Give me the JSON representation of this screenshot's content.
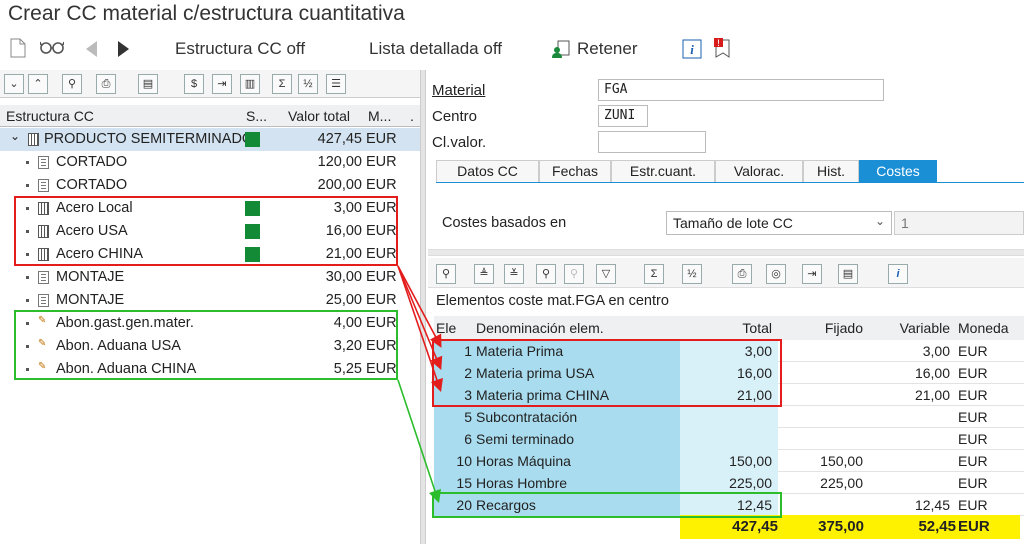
{
  "window": {
    "title": "Crear CC material c/estructura cuantitativa"
  },
  "toolbar": {
    "estructura_off": "Estructura CC off",
    "lista_off": "Lista detallada off",
    "retener": "Retener"
  },
  "tree": {
    "headers": {
      "estructura": "Estructura CC",
      "s": "S...",
      "valor": "Valor total",
      "m": "M...",
      "dot": "."
    },
    "rows": [
      {
        "label": "PRODUCTO SEMITERMINADO",
        "value": "427,45",
        "cur": "EUR"
      },
      {
        "label": "CORTADO",
        "value": "120,00",
        "cur": "EUR"
      },
      {
        "label": "CORTADO",
        "value": "200,00",
        "cur": "EUR"
      },
      {
        "label": "Acero Local",
        "value": "3,00",
        "cur": "EUR"
      },
      {
        "label": "Acero USA",
        "value": "16,00",
        "cur": "EUR"
      },
      {
        "label": "Acero CHINA",
        "value": "21,00",
        "cur": "EUR"
      },
      {
        "label": "MONTAJE",
        "value": "30,00",
        "cur": "EUR"
      },
      {
        "label": "MONTAJE",
        "value": "25,00",
        "cur": "EUR"
      },
      {
        "label": "Abon.gast.gen.mater.",
        "value": "4,00",
        "cur": "EUR"
      },
      {
        "label": "Abon. Aduana USA",
        "value": "3,20",
        "cur": "EUR"
      },
      {
        "label": "Abon. Aduana CHINA",
        "value": "5,25",
        "cur": "EUR"
      }
    ]
  },
  "form": {
    "material_label": "Material",
    "material_value": "FGA",
    "centro_label": "Centro",
    "centro_value": "ZUNI",
    "clvalor_label": "Cl.valor.",
    "clvalor_value": ""
  },
  "tabs": [
    "Datos CC",
    "Fechas",
    "Estr.cuant.",
    "Valorac.",
    "Hist.",
    "Costes"
  ],
  "costes": {
    "label": "Costes basados en",
    "selected": "Tamaño de lote CC",
    "extra": "1"
  },
  "grid": {
    "title": "Elementos coste mat.FGA en centro",
    "headers": {
      "ele": "Ele",
      "den": "Denominación elem.",
      "tot": "Total",
      "fij": "Fijado",
      "var": "Variable",
      "mon": "Moneda"
    },
    "rows": [
      {
        "ele": "1",
        "den": "Materia Prima",
        "tot": "3,00",
        "fij": "",
        "var": "3,00",
        "mon": "EUR"
      },
      {
        "ele": "2",
        "den": "Materia prima USA",
        "tot": "16,00",
        "fij": "",
        "var": "16,00",
        "mon": "EUR"
      },
      {
        "ele": "3",
        "den": "Materia prima CHINA",
        "tot": "21,00",
        "fij": "",
        "var": "21,00",
        "mon": "EUR"
      },
      {
        "ele": "5",
        "den": "Subcontratación",
        "tot": "",
        "fij": "",
        "var": "",
        "mon": "EUR"
      },
      {
        "ele": "6",
        "den": "Semi terminado",
        "tot": "",
        "fij": "",
        "var": "",
        "mon": "EUR"
      },
      {
        "ele": "10",
        "den": "Horas Máquina",
        "tot": "150,00",
        "fij": "150,00",
        "var": "",
        "mon": "EUR"
      },
      {
        "ele": "15",
        "den": "Horas Hombre",
        "tot": "225,00",
        "fij": "225,00",
        "var": "",
        "mon": "EUR"
      },
      {
        "ele": "20",
        "den": "Recargos",
        "tot": "12,45",
        "fij": "",
        "var": "12,45",
        "mon": "EUR"
      }
    ],
    "totals": {
      "tot": "427,45",
      "fij": "375,00",
      "var": "52,45",
      "mon": "EUR"
    }
  }
}
